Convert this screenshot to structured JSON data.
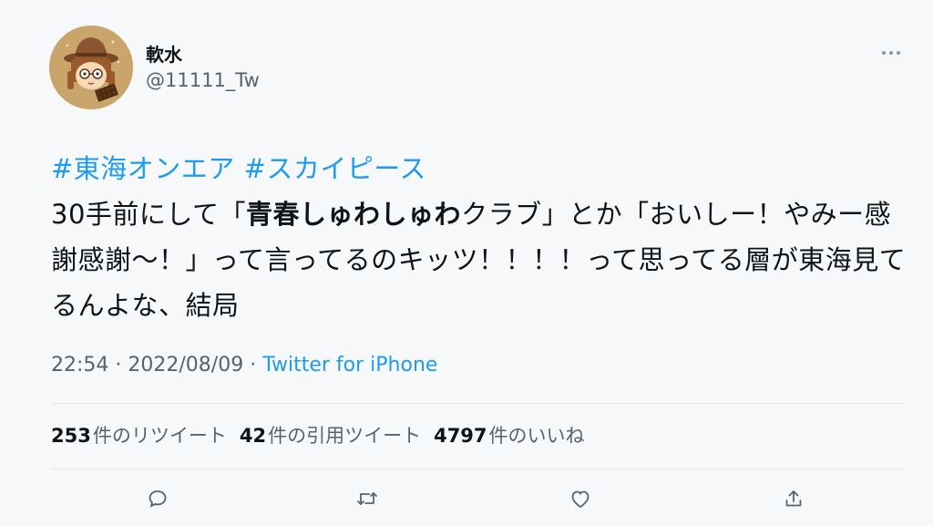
{
  "user": {
    "display_name": "軟水",
    "handle": "@11111_Tw"
  },
  "tweet": {
    "hashtag_1": "#東海オンエア",
    "hashtag_2": "#スカイピース",
    "text_part_1": "30手前にして「",
    "text_bold": "青春しゅわしゅわ",
    "text_part_2": "クラブ」とか「おいしー！やみー感謝感謝〜！」って言ってるのキッツ！！！！って思ってる層が東海見てるんよな、結局"
  },
  "meta": {
    "time": "22:54",
    "separator": " · ",
    "date": "2022/08/09",
    "separator_2": " · ",
    "source": "Twitter for iPhone"
  },
  "stats": {
    "retweets_count": "253",
    "retweets_label": "件のリツイート",
    "quotes_count": "42",
    "quotes_label": "件の引用ツイート",
    "likes_count": "4797",
    "likes_label": "件のいいね"
  },
  "icons": {
    "more": "more-horizontal-icon",
    "reply": "reply-icon",
    "retweet": "retweet-icon",
    "like": "heart-icon",
    "share": "share-icon"
  },
  "colors": {
    "accent": "#1d9bf0",
    "secondary_text": "#536471",
    "primary_text": "#0f1419",
    "background": "#f7f8f9"
  }
}
